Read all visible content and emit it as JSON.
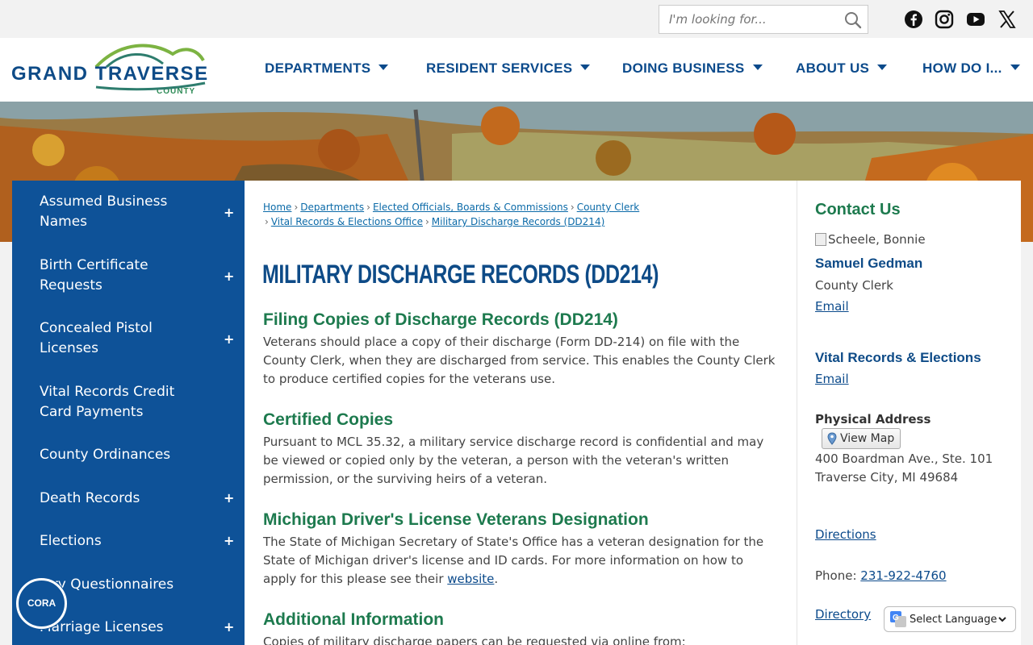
{
  "search": {
    "placeholder": "I'm looking for..."
  },
  "social": [
    "facebook-icon",
    "instagram-icon",
    "youtube-icon",
    "x-icon"
  ],
  "logo": {
    "line1": "GRAND TRAVERSE",
    "line2": "COUNTY"
  },
  "nav": [
    {
      "label": "DEPARTMENTS"
    },
    {
      "label": "RESIDENT SERVICES"
    },
    {
      "label": "DOING BUSINESS"
    },
    {
      "label": "ABOUT US"
    },
    {
      "label": "HOW DO I..."
    }
  ],
  "sidebar": {
    "items": [
      {
        "label": "Assumed Business Names",
        "expandable": true
      },
      {
        "label": "Birth Certificate Requests",
        "expandable": true
      },
      {
        "label": "Concealed Pistol Licenses",
        "expandable": true
      },
      {
        "label": "Vital Records Credit Card Payments",
        "expandable": false
      },
      {
        "label": "County Ordinances",
        "expandable": false
      },
      {
        "label": "Death Records",
        "expandable": true
      },
      {
        "label": "Elections",
        "expandable": true
      },
      {
        "label": "Jury Questionnaires",
        "expandable": false
      },
      {
        "label": "Marriage Licenses",
        "expandable": true
      }
    ]
  },
  "cora": {
    "label": "CORA"
  },
  "breadcrumb": {
    "items": [
      "Home",
      "Departments",
      "Elected Officials, Boards & Commissions",
      "County Clerk",
      "Vital Records & Elections Office",
      "Military Discharge Records (DD214)"
    ]
  },
  "main": {
    "title": "MILITARY DISCHARGE RECORDS (DD214)",
    "sections": [
      {
        "heading": "Filing Copies of Discharge Records (DD214)",
        "body": "Veterans should place a copy of their discharge (Form DD-214) on file with the County Clerk, when they are discharged from service.  This enables the County Clerk to produce certified copies for the veterans use."
      },
      {
        "heading": "Certified Copies",
        "body": "Pursuant to MCL 35.32, a military service discharge record is confidential and may be viewed or copied only by the veteran, a person with the veteran's written permission, or the surviving heirs of a veteran."
      },
      {
        "heading": "Michigan Driver's License Veterans Designation",
        "body": "The State of Michigan Secretary of State's Office has a veteran designation for the State of Michigan driver's license and ID cards.  For more information on how to apply for this please see their ",
        "link": "website",
        "after": "."
      },
      {
        "heading": "Additional Information",
        "body": "Copies of military discharge papers can be requested via online from:"
      }
    ]
  },
  "contact": {
    "heading": "Contact Us",
    "img_alt": "Scheele, Bonnie",
    "name": "Samuel Gedman",
    "role": "County Clerk",
    "email1": "Email",
    "dept": "Vital Records & Elections",
    "email2": "Email",
    "address_label": "Physical Address",
    "map_button": "View Map",
    "address_line1": "400 Boardman Ave., Ste. 101",
    "address_line2": "Traverse City, MI 49684",
    "directions": "Directions",
    "phone_label": "Phone: ",
    "phone": "231-922-4760",
    "directory": "Directory"
  },
  "translate": {
    "label": "Select Language"
  }
}
